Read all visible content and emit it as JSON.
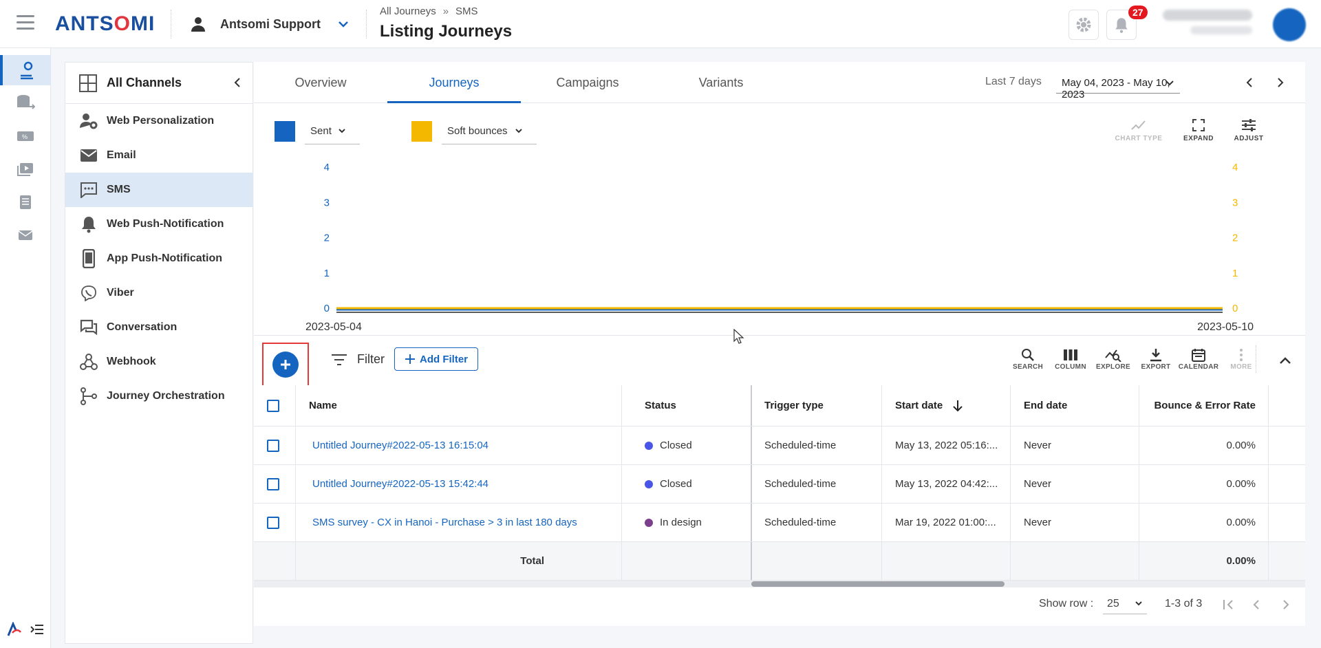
{
  "header": {
    "logo": "ANTSOMI",
    "account_name": "Antsomi Support",
    "breadcrumb": [
      "All Journeys",
      "SMS"
    ],
    "breadcrumb_sep": "»",
    "title": "Listing Journeys",
    "notification_count": "27"
  },
  "channels": {
    "title": "All Channels",
    "items": [
      {
        "label": "Web Personalization",
        "icon": "web-personalization-icon"
      },
      {
        "label": "Email",
        "icon": "email-icon"
      },
      {
        "label": "SMS",
        "icon": "sms-icon",
        "active": true
      },
      {
        "label": "Web Push-Notification",
        "icon": "bell-icon"
      },
      {
        "label": "App Push-Notification",
        "icon": "phone-icon"
      },
      {
        "label": "Viber",
        "icon": "viber-icon"
      },
      {
        "label": "Conversation",
        "icon": "conversation-icon"
      },
      {
        "label": "Webhook",
        "icon": "webhook-icon"
      },
      {
        "label": "Journey Orchestration",
        "icon": "orchestration-icon"
      }
    ]
  },
  "tabs": [
    "Overview",
    "Journeys",
    "Campaigns",
    "Variants"
  ],
  "active_tab": "Journeys",
  "date": {
    "label": "Last 7 days",
    "range": "May 04, 2023 - May 10, 2023"
  },
  "legend": [
    {
      "label": "Sent",
      "color": "#1565c0"
    },
    {
      "label": "Soft bounces",
      "color": "#f5b800"
    }
  ],
  "chart_tools": {
    "chart_type": "CHART TYPE",
    "expand": "EXPAND",
    "adjust": "ADJUST"
  },
  "chart_data": {
    "type": "line",
    "x": [
      "2023-05-04",
      "2023-05-05",
      "2023-05-06",
      "2023-05-07",
      "2023-05-08",
      "2023-05-09",
      "2023-05-10"
    ],
    "x_tick_labels": [
      "2023-05-04",
      "2023-05-10"
    ],
    "series": [
      {
        "name": "Sent",
        "axis": "left",
        "color": "#1565c0",
        "values": [
          0,
          0,
          0,
          0,
          0,
          0,
          0
        ]
      },
      {
        "name": "Soft bounces",
        "axis": "right",
        "color": "#f5b800",
        "values": [
          0,
          0,
          0,
          0,
          0,
          0,
          0
        ]
      }
    ],
    "y_ticks": [
      "0",
      "1",
      "2",
      "3",
      "4"
    ],
    "ylim": [
      0,
      4
    ],
    "y2lim": [
      0,
      4
    ],
    "grid": false
  },
  "table_toolbar": {
    "filter": "Filter",
    "add_filter": "Add Filter",
    "tools": [
      "SEARCH",
      "COLUMN",
      "EXPLORE",
      "EXPORT",
      "CALENDAR",
      "MORE"
    ]
  },
  "table": {
    "columns": [
      "Name",
      "Status",
      "Trigger type",
      "Start date",
      "End date",
      "Bounce & Error Rate"
    ],
    "rows": [
      {
        "name": "Untitled Journey#2022-05-13 16:15:04",
        "status": "Closed",
        "status_color": "#4a55e8",
        "trigger": "Scheduled-time",
        "start": "May 13, 2022 05:16:...",
        "end": "Never",
        "rate": "0.00%"
      },
      {
        "name": "Untitled Journey#2022-05-13 15:42:44",
        "status": "Closed",
        "status_color": "#4a55e8",
        "trigger": "Scheduled-time",
        "start": "May 13, 2022 04:42:...",
        "end": "Never",
        "rate": "0.00%"
      },
      {
        "name": "SMS survey - CX in Hanoi - Purchase > 3 in last 180 days",
        "status": "In design",
        "status_color": "#7b3f8c",
        "trigger": "Scheduled-time",
        "start": "Mar 19, 2022 01:00:...",
        "end": "Never",
        "rate": "0.00%"
      }
    ],
    "total_label": "Total",
    "total_rate": "0.00%"
  },
  "pager": {
    "show_row_label": "Show row :",
    "rows": "25",
    "count": "1-3 of 3"
  }
}
